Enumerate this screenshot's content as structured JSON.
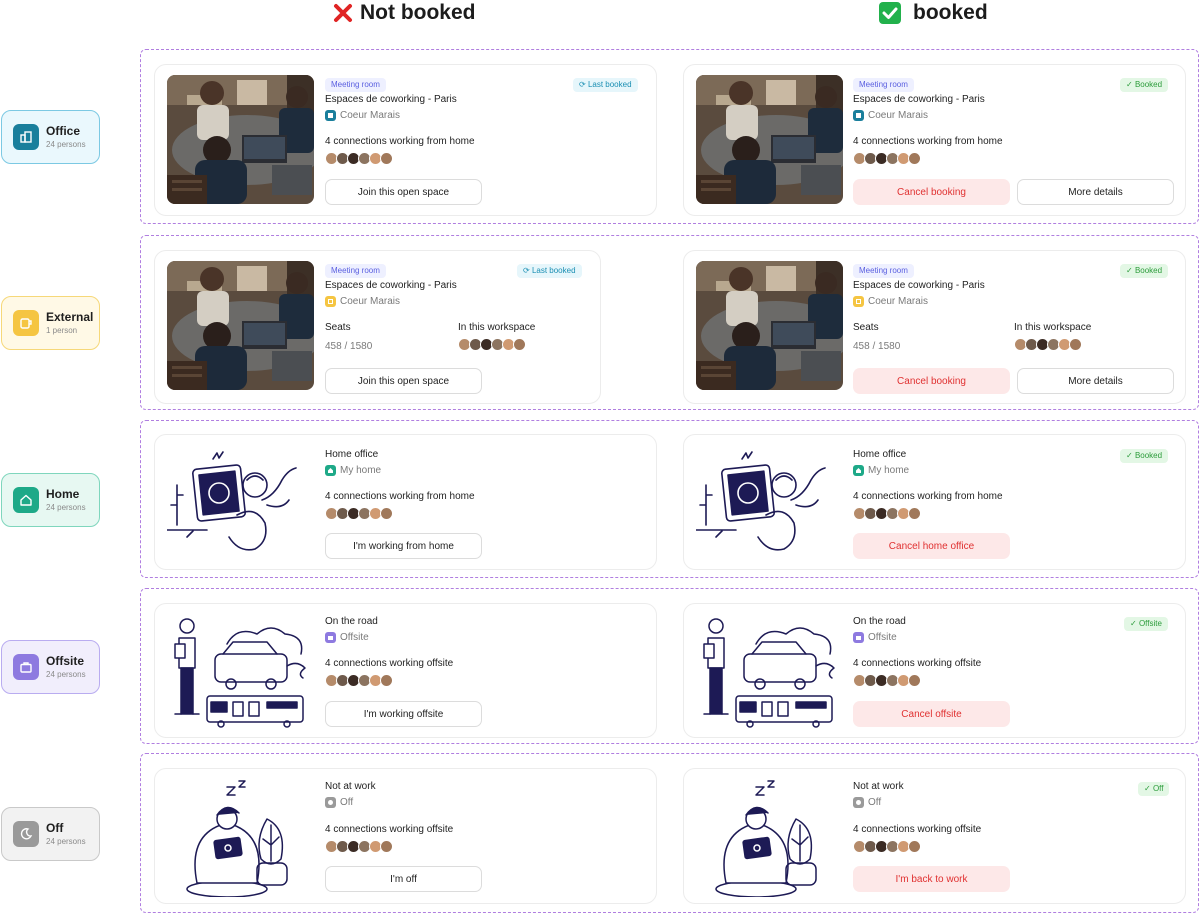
{
  "headers": {
    "not_booked": "Not booked",
    "booked": "booked"
  },
  "categories": [
    {
      "name": "Office",
      "count": "24 persons",
      "color": "#1a7f9c",
      "bg": "#eaf8fd",
      "border": "#7cc9e3",
      "icon": "building-icon"
    },
    {
      "name": "External",
      "count": "1 person",
      "color": "#f5c542",
      "bg": "#fff9e6",
      "border": "#f6d879",
      "icon": "mug-icon"
    },
    {
      "name": "Home",
      "count": "24 persons",
      "color": "#1ea988",
      "bg": "#e7f8f2",
      "border": "#7fd6bd",
      "icon": "home-icon"
    },
    {
      "name": "Offsite",
      "count": "24 persons",
      "color": "#8e7ae0",
      "bg": "#f1eefc",
      "border": "#b9acf0",
      "icon": "briefcase-icon"
    },
    {
      "name": "Off",
      "count": "24 persons",
      "color": "#9a9a9a",
      "bg": "#f2f2f2",
      "border": "#c9c9c9",
      "icon": "moon-icon"
    }
  ],
  "office": {
    "room_tag": "Meeting room",
    "last_tag": "Last booked",
    "booked_tag": "Booked",
    "title": "Espaces de coworking - Paris",
    "location": "Coeur Marais",
    "connections": "4 connections working from home",
    "join": "Join this open space",
    "cancel": "Cancel booking",
    "details": "More details"
  },
  "external": {
    "room_tag": "Meeting room",
    "last_tag": "Last booked",
    "booked_tag": "Booked",
    "title": "Espaces de coworking - Paris",
    "location": "Coeur Marais",
    "seats_label": "Seats",
    "seats_value": "458 / 1580",
    "workspace_label": "In this workspace",
    "join": "Join this open space",
    "cancel": "Cancel booking",
    "details": "More details"
  },
  "home": {
    "title": "Home office",
    "location": "My home",
    "connections": "4 connections working from home",
    "action": "I'm working from home",
    "booked_tag": "Booked",
    "cancel": "Cancel home office"
  },
  "offsite": {
    "title": "On the road",
    "location": "Offsite",
    "connections": "4 connections working offsite",
    "action": "I'm working offsite",
    "booked_tag": "Offsite",
    "cancel": "Cancel offsite"
  },
  "off": {
    "title": "Not at work",
    "location": "Off",
    "connections": "4 connections working offsite",
    "action": "I'm off",
    "booked_tag": "Off",
    "cancel": "I'm back to work"
  }
}
